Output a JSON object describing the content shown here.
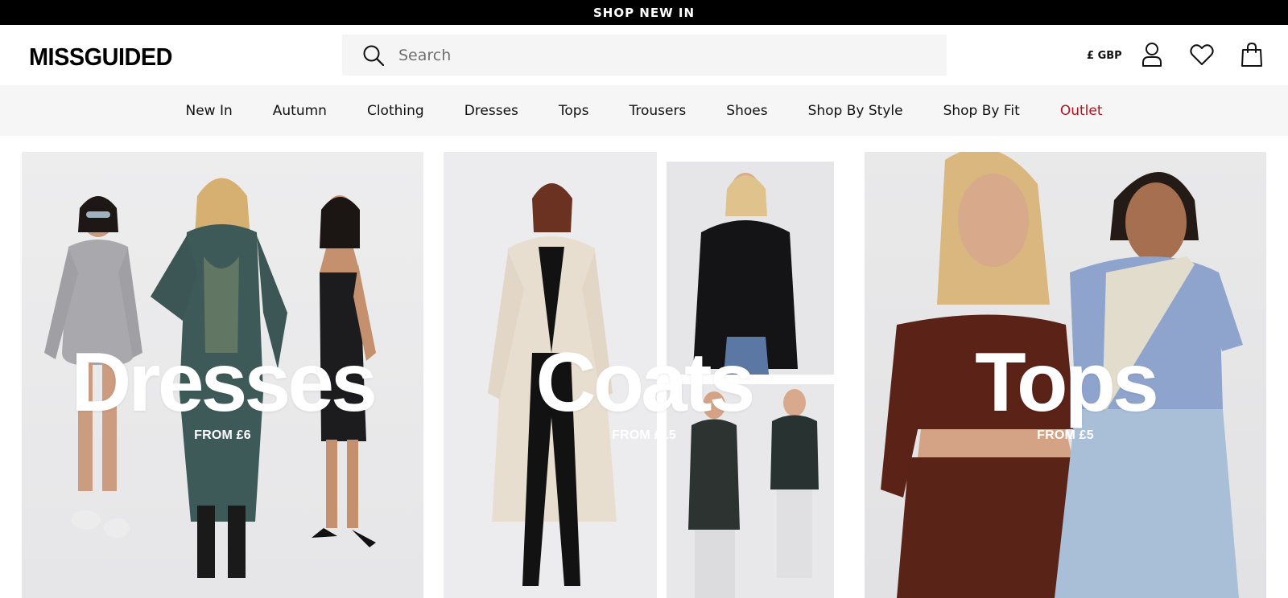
{
  "promo": {
    "label": "SHOP NEW IN"
  },
  "header": {
    "logo": "MISSGUIDED",
    "search_placeholder": "Search",
    "currency": "£ GBP",
    "icons": [
      "search-icon",
      "account-icon",
      "heart-icon",
      "shopping-bag-icon"
    ]
  },
  "nav": {
    "items": [
      {
        "label": "New In"
      },
      {
        "label": "Autumn"
      },
      {
        "label": "Clothing"
      },
      {
        "label": "Dresses"
      },
      {
        "label": "Tops"
      },
      {
        "label": "Trousers"
      },
      {
        "label": "Shoes"
      },
      {
        "label": "Shop By Style"
      },
      {
        "label": "Shop By Fit"
      },
      {
        "label": "Outlet"
      }
    ],
    "outlet_color": "#b3121d"
  },
  "tiles": [
    {
      "title": "Dresses",
      "subtitle": "FROM £6"
    },
    {
      "title": "Coats",
      "subtitle": "FROM £15"
    },
    {
      "title": "Tops",
      "subtitle": "FROM £5"
    }
  ],
  "colors": {
    "promo_bg": "#000000",
    "nav_bg": "#f6f6f6",
    "search_bg": "#f5f5f5"
  }
}
